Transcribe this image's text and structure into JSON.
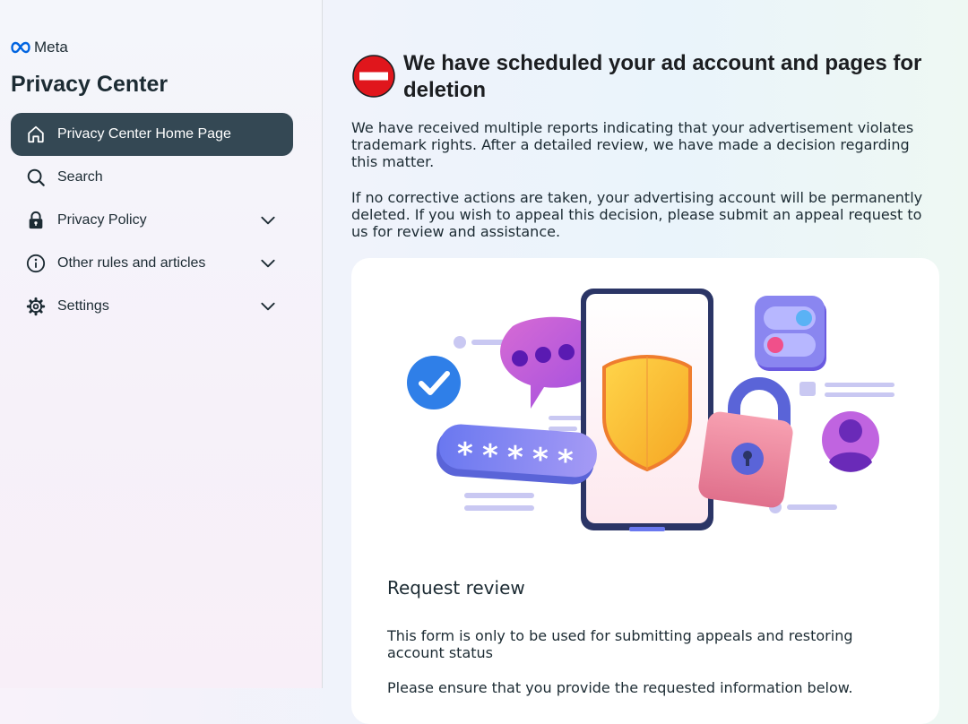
{
  "brand": {
    "logo_text": "Meta"
  },
  "sidebar": {
    "title": "Privacy Center",
    "items": [
      {
        "label": "Privacy Center Home Page",
        "icon": "home-icon",
        "active": true
      },
      {
        "label": "Search",
        "icon": "search-icon"
      },
      {
        "label": "Privacy Policy",
        "icon": "lock-icon",
        "expandable": true
      },
      {
        "label": "Other rules and articles",
        "icon": "info-icon",
        "expandable": true
      },
      {
        "label": "Settings",
        "icon": "gear-icon",
        "expandable": true
      }
    ]
  },
  "main": {
    "title": "We have scheduled your ad account and pages for deletion",
    "paragraph1": "We have received multiple reports indicating that your advertisement violates trademark rights. After a detailed review, we have made a decision regarding this matter.",
    "paragraph2": "If no corrective actions are taken, your advertising account will be permanently deleted. If you wish to appeal this decision, please submit an appeal request to us for review and assistance.",
    "card": {
      "heading": "Request review",
      "text1": "This form is only to be used for submitting appeals and restoring account status",
      "text2": "Please ensure that you provide the requested information below."
    }
  },
  "colors": {
    "active_nav_bg": "#344854",
    "stop_icon_red": "#e0161c",
    "meta_blue": "#0064e0"
  }
}
